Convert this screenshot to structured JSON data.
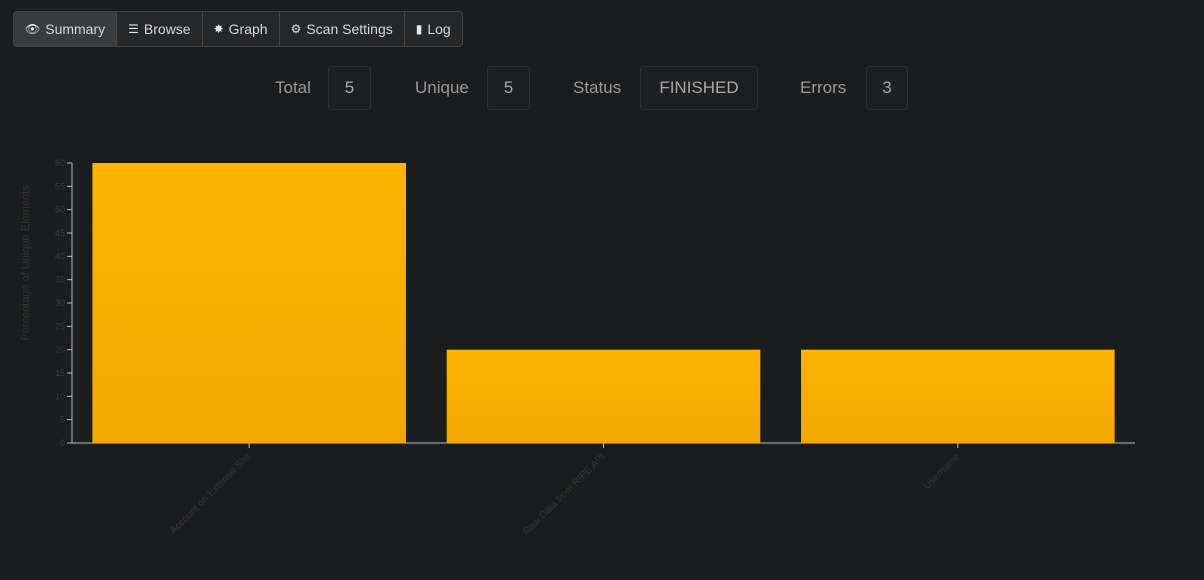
{
  "tabs": [
    {
      "label": "Summary",
      "icon": "eye-icon",
      "glyph": "👁",
      "active": true
    },
    {
      "label": "Browse",
      "icon": "list-icon",
      "glyph": "☰",
      "active": false
    },
    {
      "label": "Graph",
      "icon": "asterisk-icon",
      "glyph": "✸",
      "active": false
    },
    {
      "label": "Scan Settings",
      "icon": "gear-icon",
      "glyph": "⚙",
      "active": false
    },
    {
      "label": "Log",
      "icon": "book-icon",
      "glyph": "▮",
      "active": false
    }
  ],
  "stats": {
    "total_label": "Total",
    "total_value": "5",
    "unique_label": "Unique",
    "unique_value": "5",
    "status_label": "Status",
    "status_value": "FINISHED",
    "errors_label": "Errors",
    "errors_value": "3"
  },
  "chart_data": {
    "type": "bar",
    "ylabel": "Percentage of Unique Elements",
    "categories": [
      "Account on External Site",
      "Raw Data from RIPE API",
      "Username"
    ],
    "values": [
      60,
      20,
      20
    ],
    "ylim": [
      0,
      60
    ],
    "yticks": [
      "0",
      "5",
      "10",
      "15",
      "20",
      "25",
      "30",
      "35",
      "40",
      "45",
      "50",
      "55",
      "60"
    ],
    "bar_color": "#fdb300",
    "bar_color_bottom": "#f2a800"
  }
}
